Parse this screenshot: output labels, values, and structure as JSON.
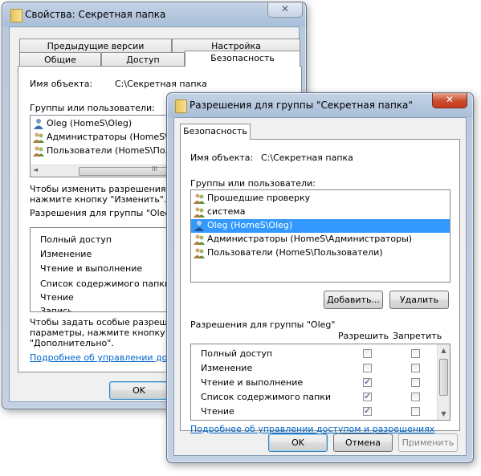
{
  "back_window": {
    "title": "Свойства: Секретная папка",
    "close_label": "✕",
    "tabs_row1": [
      "Предыдущие версии",
      "Настройка"
    ],
    "tabs_row2": [
      "Общие",
      "Доступ",
      "Безопасность"
    ],
    "object_name_label": "Имя объекта:",
    "object_name_value": "C:\\Секретная папка",
    "groups_label": "Группы или пользователи:",
    "users": [
      "Oleg (HomeS\\Oleg)",
      "Администраторы (HomeS\\Адм",
      "Пользователи (HomeS\\Польз"
    ],
    "change_hint_1": "Чтобы изменить разрешения,",
    "change_hint_2": "нажмите кнопку \"Изменить\".",
    "perms_label": "Разрешения для группы \"Oleg\"",
    "permissions": [
      "Полный доступ",
      "Изменение",
      "Чтение и выполнение",
      "Список содержимого папки",
      "Чтение",
      "Запись"
    ],
    "special_hint_1": "Чтобы задать особые разрешения",
    "special_hint_2": "параметры, нажмите кнопку",
    "special_hint_3": "\"Дополнительно\".",
    "more_link": "Подробнее об управлении доступом",
    "ok_label": "OK",
    "scroll_grip": "III"
  },
  "front_window": {
    "title": "Разрешения для группы \"Секретная папка\"",
    "close_label": "✕",
    "tab_label": "Безопасность",
    "object_name_label": "Имя объекта:",
    "object_name_value": "C:\\Секретная папка",
    "groups_label": "Группы или пользователи:",
    "users": [
      {
        "name": "Прошедшие проверку",
        "selected": false
      },
      {
        "name": "система",
        "selected": false
      },
      {
        "name": "Oleg (HomeS\\Oleg)",
        "selected": true
      },
      {
        "name": "Администраторы (HomeS\\Администраторы)",
        "selected": false
      },
      {
        "name": "Пользователи (HomeS\\Пользователи)",
        "selected": false
      }
    ],
    "add_label": "Добавить...",
    "remove_label": "Удалить",
    "perms_label": "Разрешения для группы \"Oleg\"",
    "allow_header": "Разрешить",
    "deny_header": "Запретить",
    "permissions": [
      {
        "name": "Полный доступ",
        "allow": false,
        "deny": false
      },
      {
        "name": "Изменение",
        "allow": false,
        "deny": false
      },
      {
        "name": "Чтение и выполнение",
        "allow": true,
        "deny": false
      },
      {
        "name": "Список содержимого папки",
        "allow": true,
        "deny": false
      },
      {
        "name": "Чтение",
        "allow": true,
        "deny": false
      }
    ],
    "more_link": "Подробнее об управлении доступом и разрешениях",
    "ok_label": "OK",
    "cancel_label": "Отмена",
    "apply_label": "Применить",
    "scroll_up": "▲",
    "scroll_down": "▼"
  }
}
